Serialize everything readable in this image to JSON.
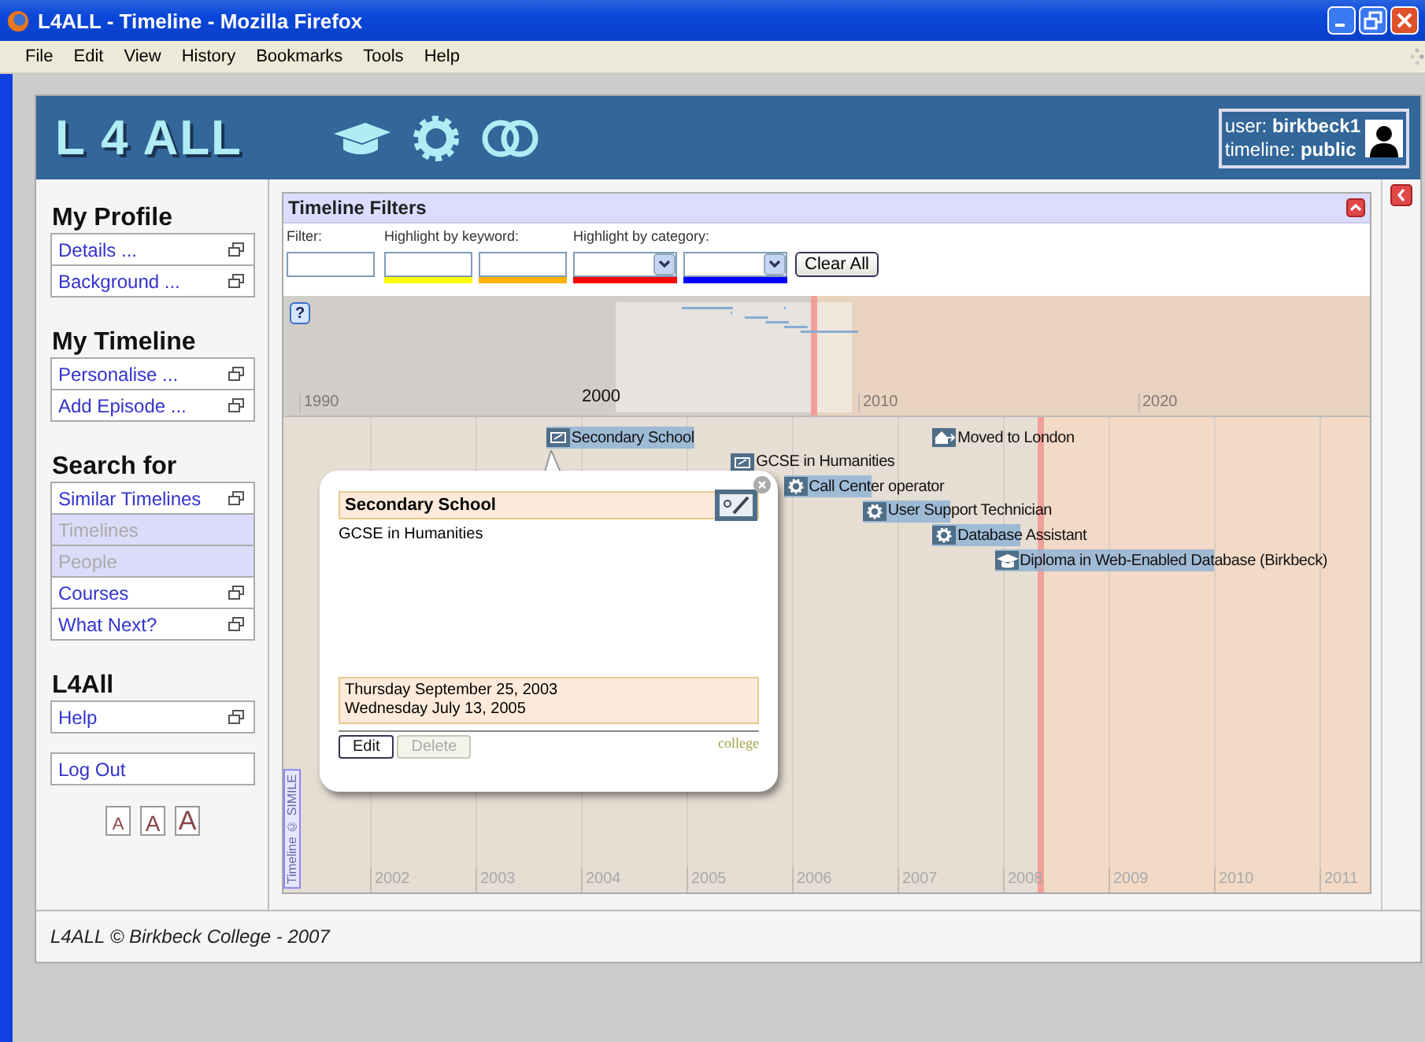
{
  "window": {
    "title": "L4ALL - Timeline - Mozilla Firefox",
    "menu": [
      "File",
      "Edit",
      "View",
      "History",
      "Bookmarks",
      "Tools",
      "Help"
    ]
  },
  "header": {
    "logo": "L 4 ALL",
    "user_label": "user:",
    "user": "birkbeck1",
    "timeline_label": "timeline:",
    "timeline": "public"
  },
  "sidebar": {
    "sections": [
      {
        "title": "My Profile",
        "items": [
          {
            "label": "Details ...",
            "disabled": false,
            "popout": true
          },
          {
            "label": "Background ...",
            "disabled": false,
            "popout": true
          }
        ]
      },
      {
        "title": "My Timeline",
        "items": [
          {
            "label": "Personalise ...",
            "disabled": false,
            "popout": true
          },
          {
            "label": "Add Episode ...",
            "disabled": false,
            "popout": true
          }
        ]
      },
      {
        "title": "Search for",
        "items": [
          {
            "label": "Similar Timelines",
            "disabled": false,
            "popout": true
          },
          {
            "label": "Timelines",
            "disabled": true,
            "popout": false
          },
          {
            "label": "People",
            "disabled": true,
            "popout": false
          },
          {
            "label": "Courses",
            "disabled": false,
            "popout": true
          },
          {
            "label": "What Next?",
            "disabled": false,
            "popout": true
          }
        ]
      },
      {
        "title": "L4All",
        "items": [
          {
            "label": "Help",
            "disabled": false,
            "popout": true
          }
        ]
      }
    ],
    "logout": "Log Out",
    "font_sizes": [
      "A",
      "A",
      "A"
    ]
  },
  "filters": {
    "title": "Timeline Filters",
    "filter_label": "Filter:",
    "keyword_label": "Highlight by keyword:",
    "category_label": "Highlight by category:",
    "keyword_fields": [
      {
        "color": "#ffff00"
      },
      {
        "color": "#ffb000"
      }
    ],
    "category_selects": [
      {
        "color": "#ff0000"
      },
      {
        "color": "#0000ff"
      }
    ],
    "clear": "Clear All"
  },
  "timeline": {
    "help": "?",
    "overview_years": [
      {
        "label": "1990",
        "highlighted": false
      },
      {
        "label": "2000",
        "highlighted": true
      },
      {
        "label": "2010",
        "highlighted": false
      },
      {
        "label": "2020",
        "highlighted": false
      }
    ],
    "years": [
      "2002",
      "2003",
      "2004",
      "2005",
      "2006",
      "2007",
      "2008",
      "2009",
      "2010",
      "2011"
    ],
    "tracks": [
      {
        "events": [
          {
            "label": "Secondary School",
            "kind": "certificate"
          },
          {
            "label": "Moved to London",
            "kind": "house"
          }
        ]
      },
      {
        "events": [
          {
            "label": "GCSE in Humanities",
            "kind": "certificate"
          }
        ]
      },
      {
        "events": [
          {
            "label": "Call Center operator",
            "kind": "gear"
          }
        ]
      },
      {
        "events": [
          {
            "label": "User Support Technician",
            "kind": "gear"
          }
        ]
      },
      {
        "events": [
          {
            "label": "Database Assistant",
            "kind": "gear"
          }
        ]
      },
      {
        "events": [
          {
            "label": "Diploma in Web-Enabled Database (Birkbeck)",
            "kind": "graduation"
          }
        ]
      }
    ],
    "popup": {
      "title": "Secondary School",
      "description": "GCSE in Humanities",
      "dates": [
        "Thursday September 25, 2003",
        "Wednesday July 13, 2005"
      ],
      "buttons": [
        {
          "label": "Edit",
          "disabled": false
        },
        {
          "label": "Delete",
          "disabled": true
        }
      ],
      "category": "college"
    },
    "credit": "Timeline © SIMILE"
  },
  "footer": "L4ALL © Birkbeck College - 2007"
}
